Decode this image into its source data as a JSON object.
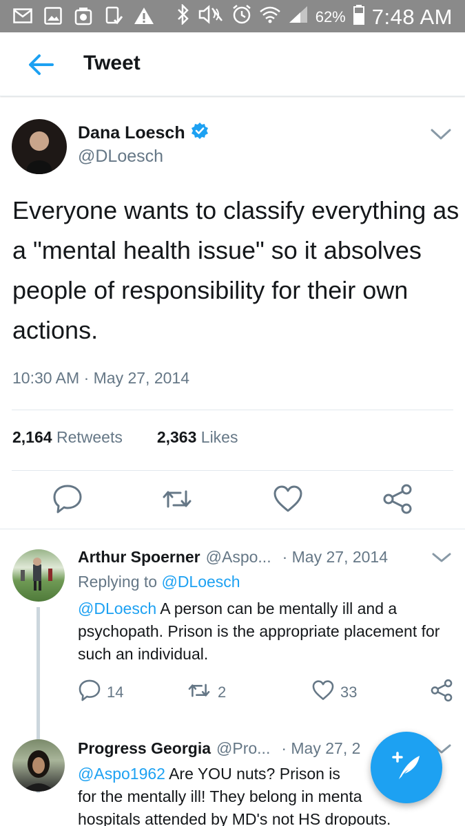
{
  "status_bar": {
    "battery": "62%",
    "time": "7:48 AM",
    "icons": [
      "mail-icon",
      "image-icon",
      "app-icon",
      "phone-check-icon",
      "warning-icon",
      "bluetooth-icon",
      "mute-icon",
      "alarm-icon",
      "wifi-icon",
      "signal-icon",
      "battery-icon"
    ]
  },
  "header": {
    "title": "Tweet",
    "back_icon": "back-arrow-icon"
  },
  "tweet": {
    "name": "Dana Loesch",
    "handle": "@DLoesch",
    "text": "Everyone wants to classify everything as a \"mental health issue\" so it absolves people of responsibility for their own actions.",
    "timestamp": "10:30 AM · May 27, 2014",
    "retweets_count": "2,164",
    "retweets_label": "Retweets",
    "likes_count": "2,363",
    "likes_label": "Likes"
  },
  "replies": [
    {
      "name": "Arthur Spoerner",
      "handle": "@Aspo...",
      "date": "· May 27, 2014",
      "replying_prefix": "Replying to",
      "replying_to": "@DLoesch",
      "mention": "@DLoesch",
      "text": " A person can be mentally ill and a psychopath. Prison is the appropriate placement for such an individual.",
      "reply_count": "14",
      "retweet_count": "2",
      "like_count": "33"
    },
    {
      "name": "Progress Georgia",
      "handle": "@Pro...",
      "date": "· May 27, 2",
      "mention": "@Aspo1962",
      "text": " Are YOU nuts? Prison is",
      "text_line2": "for the mentally ill! They belong in menta",
      "text_line3": "hospitals attended by MD's not HS dropouts."
    }
  ],
  "fab": {
    "icon": "compose-tweet-icon"
  },
  "colors": {
    "accent": "#1da1f2",
    "text": "#14171a",
    "muted": "#657786",
    "divider": "#e1e8ed",
    "status_bar": "#8a8a8a"
  }
}
